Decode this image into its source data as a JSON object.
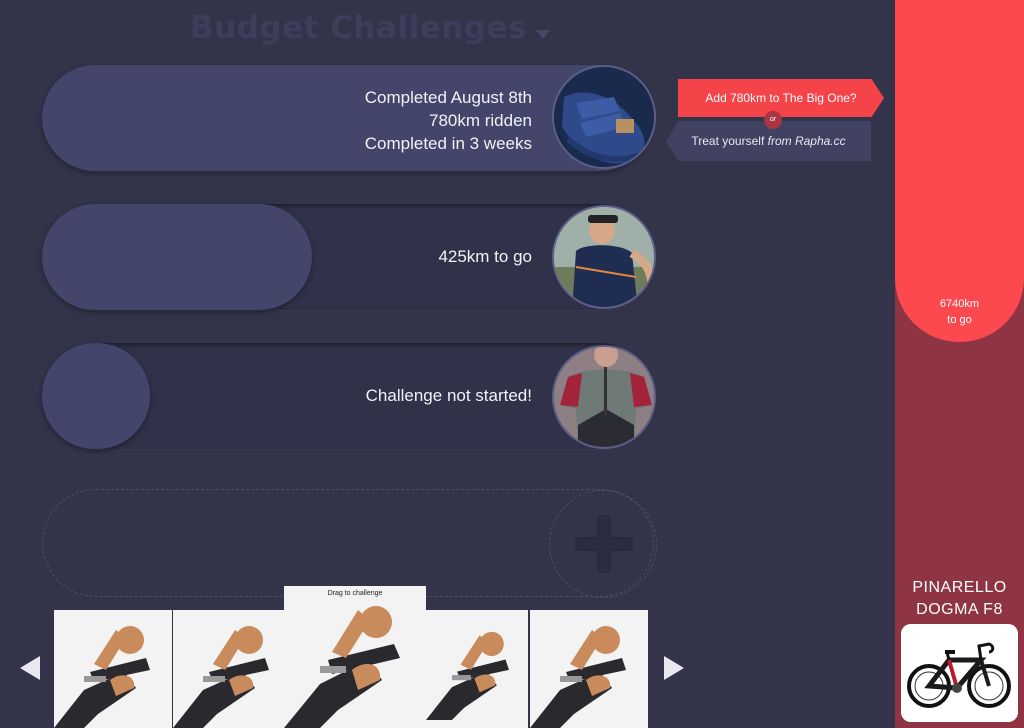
{
  "header": {
    "title": "Budget Challenges",
    "dropdown_icon": "chevron-down-icon"
  },
  "challenges": [
    {
      "status": "completed",
      "progress": 1.0,
      "lines": [
        "Completed August 8th",
        "780km ridden",
        "Completed in 3 weeks"
      ],
      "image": "cycling-shoe"
    },
    {
      "status": "in-progress",
      "progress": 0.42,
      "lines": [
        "425km to go"
      ],
      "image": "cyclist-jersey"
    },
    {
      "status": "not-started",
      "progress": 0.0,
      "lines": [
        "Challenge not started!"
      ],
      "image": "cycling-jersey-back"
    }
  ],
  "reward": {
    "add_label": "Add 780km to The Big One?",
    "or_label": "or",
    "treat_prefix": "Treat yourself ",
    "treat_source": "from Rapha.cc"
  },
  "add_challenge": {
    "icon": "plus-icon"
  },
  "carousel": {
    "drag_hint": "Drag to challenge",
    "prev_icon": "arrow-left-icon",
    "next_icon": "arrow-right-icon",
    "items": [
      "arm-warmers",
      "arm-warmers",
      "arm-warmers",
      "arm-warmers",
      "arm-warmers"
    ]
  },
  "goal": {
    "remaining_value": "6740km",
    "remaining_suffix": "to go",
    "name_line1": "PINARELLO",
    "name_line2": "DOGMA F8",
    "progress": 0.47
  },
  "colors": {
    "background": "#33334a",
    "track": "#31314a",
    "fill": "#44456a",
    "accent_red": "#fc484f",
    "goal_dark": "#8e3442",
    "callout_dark": "#414262"
  }
}
